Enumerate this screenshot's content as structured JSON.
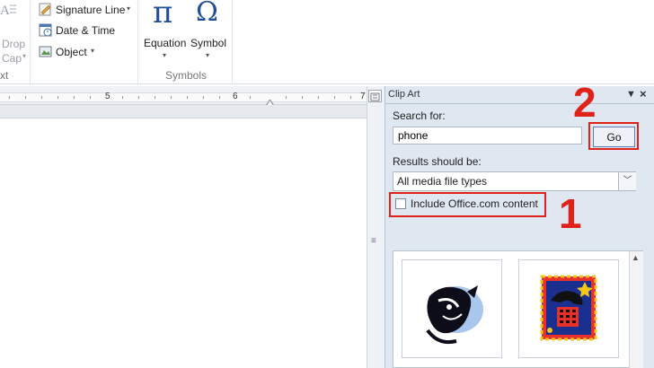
{
  "ribbon": {
    "drop_cap_line1": "Drop",
    "drop_cap_line2": "Cap",
    "text_group_partial": "xt",
    "signature_line": "Signature Line",
    "date_time": "Date & Time",
    "object": "Object",
    "equation": "Equation",
    "symbol": "Symbol",
    "symbols_group": "Symbols",
    "pi_glyph": "π",
    "omega_glyph": "Ω"
  },
  "ruler": {
    "mark_5": "5",
    "mark_6": "6",
    "mark_7": "7"
  },
  "clip_art": {
    "title": "Clip Art",
    "search_label": "Search for:",
    "search_value": "phone",
    "go_label": "Go",
    "results_label": "Results should be:",
    "results_value": "All media file types",
    "include_label": "Include Office.com content",
    "include_checked": false
  },
  "annotations": {
    "step1": "1",
    "step2": "2",
    "color": "#e0221b"
  }
}
